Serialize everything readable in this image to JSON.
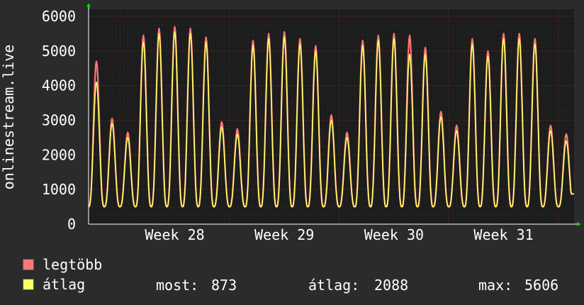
{
  "colors": {
    "background": "#2b2b2b",
    "plot_bg": "#1c1c1c",
    "grid": "#5a2020",
    "grid_minor": "#3a3a3a",
    "max_series": "#ff7777",
    "avg_series": "#ffff66",
    "axis": "#ffffff",
    "arrow": "#00dd00"
  },
  "legend": {
    "max_label": "legtöbb",
    "avg_label": "átlag"
  },
  "stats": {
    "current_label": "most:",
    "current_value": "873",
    "avg_label": "átlag:",
    "avg_value": "2088",
    "max_label": "max:",
    "max_value": "5606"
  },
  "chart_data": {
    "type": "line",
    "ylabel": "onlinestream.live",
    "ylim": [
      0,
      6000
    ],
    "yticks": [
      0,
      1000,
      2000,
      3000,
      4000,
      5000,
      6000
    ],
    "xlabels": [
      "Week 28",
      "Week 29",
      "Week 30",
      "Week 31"
    ],
    "day_count": 31,
    "grid": true,
    "series": [
      {
        "name": "legtöbb",
        "values": [
          4700,
          3050,
          2650,
          5450,
          5650,
          5700,
          5650,
          5400,
          2950,
          2750,
          5300,
          5500,
          5550,
          5350,
          5150,
          3150,
          2650,
          5300,
          5450,
          5500,
          5450,
          5100,
          3250,
          2850,
          5350,
          5000,
          5500,
          5500,
          5350,
          2850,
          2600
        ]
      },
      {
        "name": "átlag",
        "values": [
          4100,
          2900,
          2500,
          5250,
          5500,
          5550,
          5500,
          5250,
          2800,
          2600,
          5150,
          5350,
          5400,
          5200,
          5000,
          3000,
          2500,
          5150,
          5300,
          5350,
          4900,
          4900,
          3100,
          2700,
          5200,
          4850,
          5350,
          5350,
          5200,
          2700,
          2400
        ]
      }
    ],
    "trough": 500,
    "current": 873
  }
}
